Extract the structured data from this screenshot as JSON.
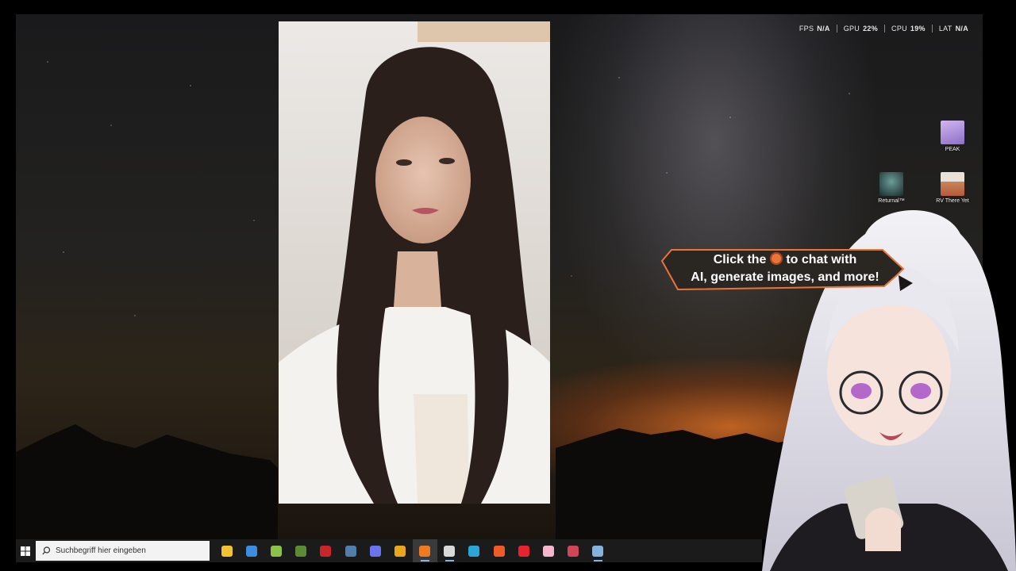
{
  "overlay_stats": [
    {
      "label": "FPS",
      "value": "N/A"
    },
    {
      "label": "GPU",
      "value": "22%"
    },
    {
      "label": "CPU",
      "value": "19%"
    },
    {
      "label": "LAT",
      "value": "N/A"
    }
  ],
  "desktop_icons": [
    {
      "label": "PEAK",
      "icon": "peak-game-icon",
      "color": "#b48fd8"
    },
    {
      "label": "Returnal™",
      "icon": "returnal-game-icon",
      "color": "#2d4c4a"
    },
    {
      "label": "RV There Yet",
      "icon": "rv-there-yet-game-icon",
      "color": "#c9845a"
    }
  ],
  "tooltip": {
    "line1_before": "Click the",
    "line1_after": "to chat with",
    "line2": "AI, generate images, and more!",
    "icon": "basketball-icon",
    "border_color": "#e8743a",
    "background": "#2a2622"
  },
  "taskbar": {
    "start_icon": "windows-start-icon",
    "search_placeholder": "Suchbegriff hier eingeben",
    "search_icon": "search-icon",
    "apps": [
      {
        "name": "file-explorer-icon",
        "color": "#f2c232",
        "running": false,
        "active": false
      },
      {
        "name": "microsoft-store-icon",
        "color": "#3c8de0",
        "running": false,
        "active": false
      },
      {
        "name": "android-studio-icon",
        "color": "#8bc34a",
        "running": false,
        "active": false
      },
      {
        "name": "minecraft-icon",
        "color": "#5b8c34",
        "running": false,
        "active": false
      },
      {
        "name": "ubisoft-red-icon",
        "color": "#c8262b",
        "running": false,
        "active": false
      },
      {
        "name": "steam-icon",
        "color": "#4f7faa",
        "running": false,
        "active": false
      },
      {
        "name": "discord-icon",
        "color": "#6a74f0",
        "running": false,
        "active": false
      },
      {
        "name": "chrome-icon",
        "color": "#e9a81c",
        "running": false,
        "active": false
      },
      {
        "name": "firefox-icon",
        "color": "#ef7a23",
        "running": true,
        "active": true
      },
      {
        "name": "obs-icon",
        "color": "#d9d9d9",
        "running": true,
        "active": false
      },
      {
        "name": "edge-icon",
        "color": "#2aa5d6",
        "running": false,
        "active": false
      },
      {
        "name": "brave-icon",
        "color": "#ef5a28",
        "running": false,
        "active": false
      },
      {
        "name": "opera-icon",
        "color": "#e8232f",
        "running": false,
        "active": false
      },
      {
        "name": "pink-app-icon",
        "color": "#f3b6cc",
        "running": false,
        "active": false
      },
      {
        "name": "red-app-icon",
        "color": "#d04656",
        "running": false,
        "active": false
      },
      {
        "name": "steam-running-icon",
        "color": "#86b3dc",
        "running": true,
        "active": false
      }
    ]
  }
}
